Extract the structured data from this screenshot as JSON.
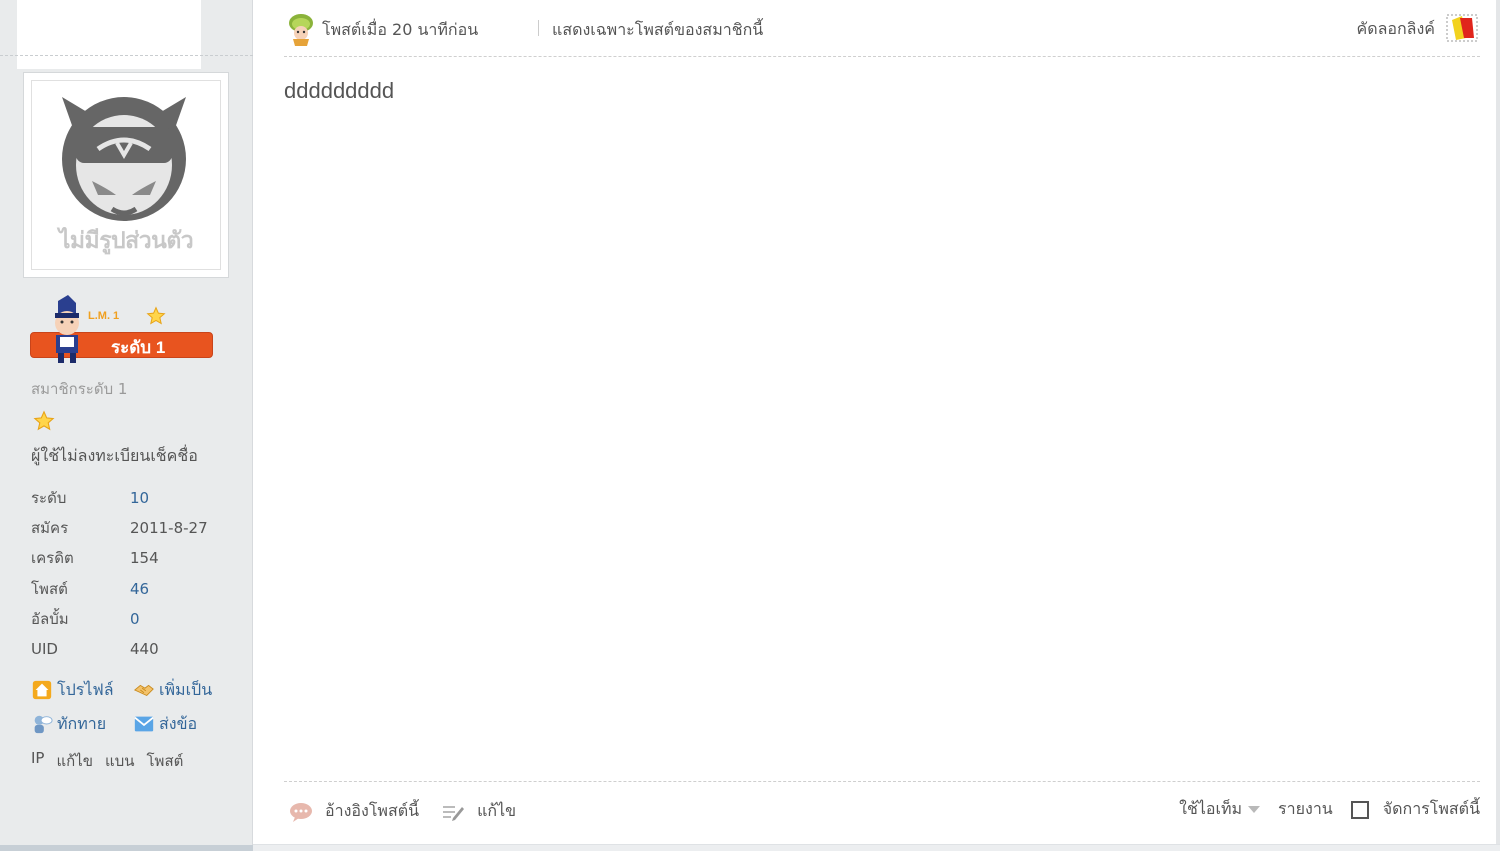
{
  "sidebar": {
    "avatar": {
      "caption": "ไม่มีรูปส่วนตัว",
      "icon": "no-avatar-face-icon"
    },
    "rank": {
      "mini_label": "L.M. 1",
      "badge_label": "ระดับ 1",
      "character_icon": "rank-character-icon",
      "star_icon": "star-icon"
    },
    "member_level": "สมาชิกระดับ 1",
    "member_note": "ผู้ใช้ไม่ลงทะเบียนเช็คชื่อ",
    "stats": [
      {
        "label": "ระดับ",
        "value": "10"
      },
      {
        "label": "สมัคร",
        "value": "2011-8-27"
      },
      {
        "label": "เครดิต",
        "value": "154"
      },
      {
        "label": "โพสต์",
        "value": "46"
      },
      {
        "label": "อัลบั้ม",
        "value": "0"
      },
      {
        "label": "UID",
        "value": "440"
      }
    ],
    "actions": {
      "profile": "โปรไฟล์",
      "add_friend": "เพิ่มเป็น",
      "greet": "ทักทาย",
      "send_message": "ส่งข้อ"
    },
    "admin_links": [
      "IP",
      "แก้ไข",
      "แบน",
      "โพสต์"
    ]
  },
  "post": {
    "time": "โพสต์เมื่อ 20 นาทีก่อน",
    "only_author": "แสดงเฉพาะโพสต์ของสมาชิกนี้",
    "copy_link": "คัดลอกลิงค์",
    "body": "ddddddddd"
  },
  "footer": {
    "quote": "อ้างอิงโพสต์นี้",
    "edit": "แก้ไข",
    "use_item": "ใช้ไอเท็ม",
    "report": "รายงาน",
    "manage": "จัดการโพสต์นี้"
  },
  "colors": {
    "rank_badge": "#e8541f",
    "link": "#336699",
    "sidebar_bg": "#e9ebec"
  }
}
